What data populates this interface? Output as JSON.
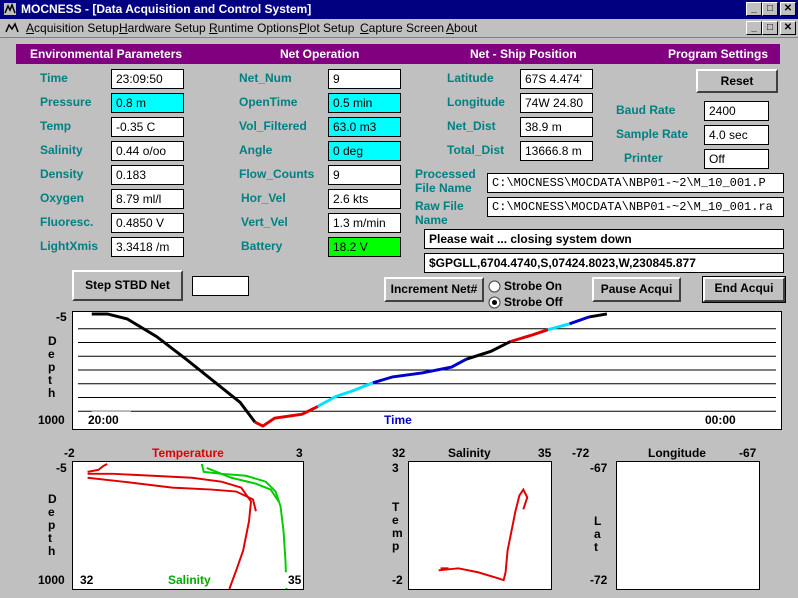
{
  "window": {
    "title": "MOCNESS - [Data Acquisition and Control System]",
    "controls": [
      "_",
      "□",
      "✕"
    ],
    "sub_controls": [
      "_",
      "□",
      "✕"
    ]
  },
  "menu": [
    "Acquisition Setup",
    "Hardware Setup",
    "Runtime Options",
    "Plot Setup",
    "Capture Screen",
    "About"
  ],
  "headers": {
    "env": "Environmental Parameters",
    "net": "Net Operation",
    "pos": "Net - Ship Position",
    "settings": "Program Settings"
  },
  "env": [
    {
      "label": "Time",
      "value": "23:09:50",
      "highlight": ""
    },
    {
      "label": "Pressure",
      "value": "0.8 m",
      "highlight": "cyan"
    },
    {
      "label": "Temp",
      "value": "-0.35 C",
      "highlight": ""
    },
    {
      "label": "Salinity",
      "value": "0.44 o/oo",
      "highlight": ""
    },
    {
      "label": "Density",
      "value": "0.183",
      "highlight": ""
    },
    {
      "label": "Oxygen",
      "value": "8.79 ml/l",
      "highlight": ""
    },
    {
      "label": "Fluoresc.",
      "value": "0.4850 V",
      "highlight": ""
    },
    {
      "label": "LightXmis",
      "value": "3.3418 /m",
      "highlight": ""
    }
  ],
  "net": [
    {
      "label": "Net_Num",
      "value": "9",
      "highlight": ""
    },
    {
      "label": "OpenTime",
      "value": "0.5 min",
      "highlight": "cyan"
    },
    {
      "label": "Vol_Filtered",
      "value": "63.0 m3",
      "highlight": "cyan"
    },
    {
      "label": "Angle",
      "value": "0 deg",
      "highlight": "cyan"
    },
    {
      "label": "Flow_Counts",
      "value": "9",
      "highlight": ""
    },
    {
      "label": "Hor_Vel",
      "value": "2.6 kts",
      "highlight": ""
    },
    {
      "label": "Vert_Vel",
      "value": "1.3 m/min",
      "highlight": ""
    },
    {
      "label": "Battery",
      "value": "18.2 V",
      "highlight": "green"
    }
  ],
  "pos": [
    {
      "label": "Latitude",
      "value": "67S 4.474'"
    },
    {
      "label": "Longitude",
      "value": "74W 24.80"
    },
    {
      "label": "Net_Dist",
      "value": "38.9 m"
    },
    {
      "label": "Total_Dist",
      "value": "13666.8 m"
    }
  ],
  "settings": {
    "reset_label": "Reset",
    "baud_label": "Baud Rate",
    "baud_value": "2400",
    "sample_label": "Sample Rate",
    "sample_value": "4.0 sec",
    "printer_label": "Printer",
    "printer_value": "Off"
  },
  "files": {
    "processed_label_1": "Processed",
    "processed_label_2": "File Name",
    "processed_value": "C:\\MOCNESS\\MOCDATA\\NBP01-~2\\M_10_001.P",
    "raw_label_1": "Raw File",
    "raw_label_2": "Name",
    "raw_value": "C:\\MOCNESS\\MOCDATA\\NBP01-~2\\M_10_001.ra"
  },
  "status": {
    "message": "Please wait ... closing system down",
    "gps": "$GPGLL,6704.4740,S,07424.8023,W,230845.877"
  },
  "buttons": {
    "step": "Step STBD Net",
    "step_input": "",
    "increment": "Increment Net#",
    "strobe_on": "Strobe On",
    "strobe_off": "Strobe Off",
    "strobe_selected": "off",
    "pause": "Pause Acqui",
    "end": "End Acqui"
  },
  "depth_plot": {
    "ylabel": "Depth",
    "y_top": "-5",
    "y_bottom": "1000",
    "x_left": "20:00",
    "x_center": "Time",
    "x_right": "00:00"
  },
  "tsplot": {
    "top_left": "-2",
    "top_title": "Temperature",
    "top_right": "3",
    "y_top": "-5",
    "ylabel": "Depth",
    "y_bottom": "1000",
    "bottom_left": "32",
    "bottom_title": "Salinity",
    "bottom_right": "35"
  },
  "salplot": {
    "top_left": "32",
    "title": "Salinity",
    "top_right": "35",
    "y_top": "3",
    "ylabel": "Temp",
    "y_bottom": "-2"
  },
  "lonplot": {
    "top_left": "-72",
    "title": "Longitude",
    "top_right": "-67",
    "y_top": "-67",
    "ylabel": "Lat",
    "y_bottom": "-72"
  },
  "colors": {
    "title_bar": "#000080",
    "header_bar": "#800080",
    "label_teal": "#008080",
    "temperature": "#ff0000",
    "salinity": "#00cc00",
    "time_axis": "#0000cc"
  }
}
